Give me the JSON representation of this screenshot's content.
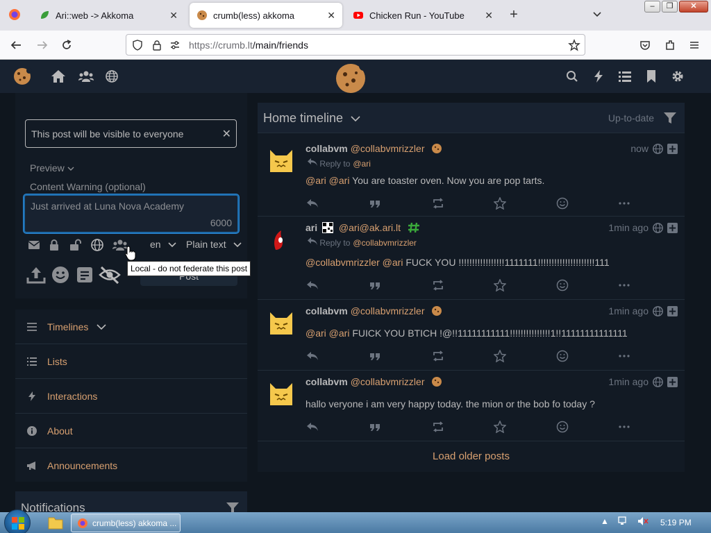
{
  "browser": {
    "tabs": [
      {
        "label": "Ari::web -> Akkoma",
        "active": false
      },
      {
        "label": "crumb(less) akkoma",
        "active": true
      },
      {
        "label": "Chicken Run - YouTube",
        "active": false
      }
    ],
    "url_host": "https://crumb.lt",
    "url_path": "/main/friends"
  },
  "postform": {
    "scope_notice": "This post will be visible to everyone",
    "preview_label": "Preview",
    "cw_placeholder": "Content Warning (optional)",
    "status_text": "Just arrived at Luna Nova Academy",
    "char_count": "6000",
    "language": "en",
    "format": "Plain text",
    "post_label": "Post",
    "tooltip": "Local - do not federate this post"
  },
  "nav": {
    "items": [
      {
        "label": "Timelines",
        "icon": "bars-icon"
      },
      {
        "label": "Lists",
        "icon": "list-icon"
      },
      {
        "label": "Interactions",
        "icon": "bolt-icon"
      },
      {
        "label": "About",
        "icon": "info-icon"
      },
      {
        "label": "Announcements",
        "icon": "bullhorn-icon"
      }
    ]
  },
  "notifications": {
    "title": "Notifications"
  },
  "timeline": {
    "title": "Home timeline",
    "status_label": "Up-to-date",
    "load_older": "Load older posts",
    "posts": [
      {
        "name": "collabvm",
        "acct": "@collabvmrizzler",
        "time": "now",
        "reply_label": "Reply to",
        "reply_to": "@ari",
        "mentions": "@ari @ari",
        "text": " You are toaster oven. Now you are pop tarts."
      },
      {
        "name": "ari",
        "acct": "@ari@ak.ari.lt",
        "time": "1min ago",
        "reply_label": "Reply to",
        "reply_to": "@collabvmrizzler",
        "mentions": "@collabvmrizzler @ari",
        "text": " FUCK YOU !!!!!!!!!!!!!!!!!1111111!!!!!!!!!!!!!!!!!!!!!111"
      },
      {
        "name": "collabvm",
        "acct": "@collabvmrizzler",
        "time": "1min ago",
        "mentions": "@ari @ari",
        "text": " FUICK YOU BTICH !@!!11111111111!!!!!!!!!!!!!!!1!!11111111111111"
      },
      {
        "name": "collabvm",
        "acct": "@collabvmrizzler",
        "time": "1min ago",
        "mentions": "",
        "text": "hallo veryone i am very happy today. the mion or the bob fo today ?"
      }
    ]
  },
  "taskbar": {
    "app_label": "crumb(less) akkoma ...",
    "clock": "5:19 PM"
  },
  "colors": {
    "accent": "#d8a070",
    "bg": "#0f161e",
    "panel": "#121a24",
    "text": "#b9b9ba"
  }
}
